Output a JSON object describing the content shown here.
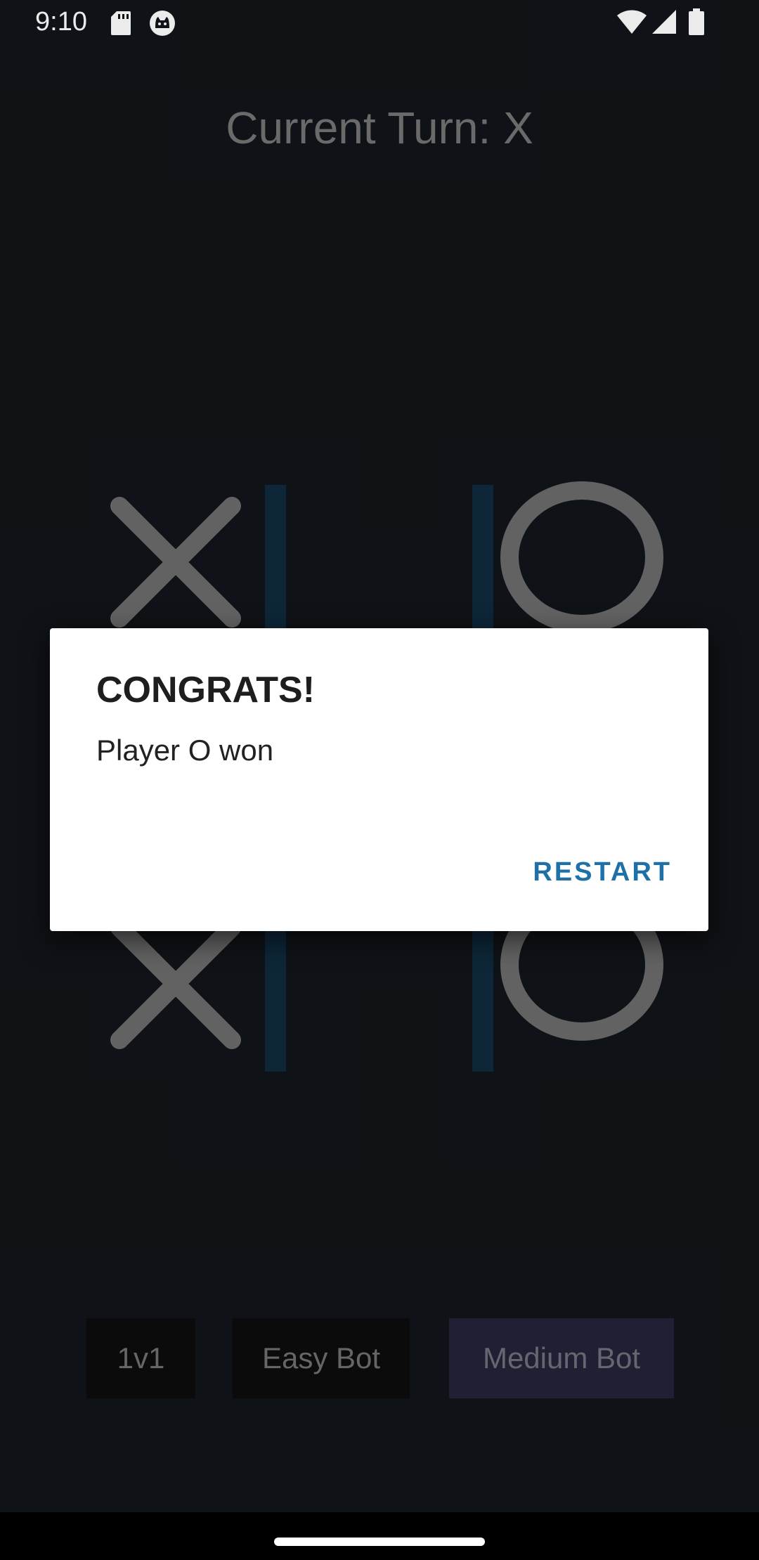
{
  "status_bar": {
    "time": "9:10",
    "icons": [
      "sd-card-icon",
      "cat-face-icon",
      "wifi-icon",
      "signal-icon",
      "battery-icon"
    ]
  },
  "game": {
    "turn_label": "Current Turn: X",
    "board": [
      [
        "X",
        "",
        "O"
      ],
      [
        "",
        "",
        ""
      ],
      [
        "X",
        "",
        "O"
      ]
    ],
    "colors": {
      "background": "#111418",
      "mark": "#6b6b6b",
      "grid_line": "#0f2a3d"
    }
  },
  "modes": [
    {
      "label": "1v1",
      "active": false
    },
    {
      "label": "Easy Bot",
      "active": false
    },
    {
      "label": "Medium Bot",
      "active": true
    }
  ],
  "dialog": {
    "title": "CONGRATS!",
    "message": "Player O won",
    "button_label": "RESTART",
    "accent_color": "#1f6fa8"
  }
}
